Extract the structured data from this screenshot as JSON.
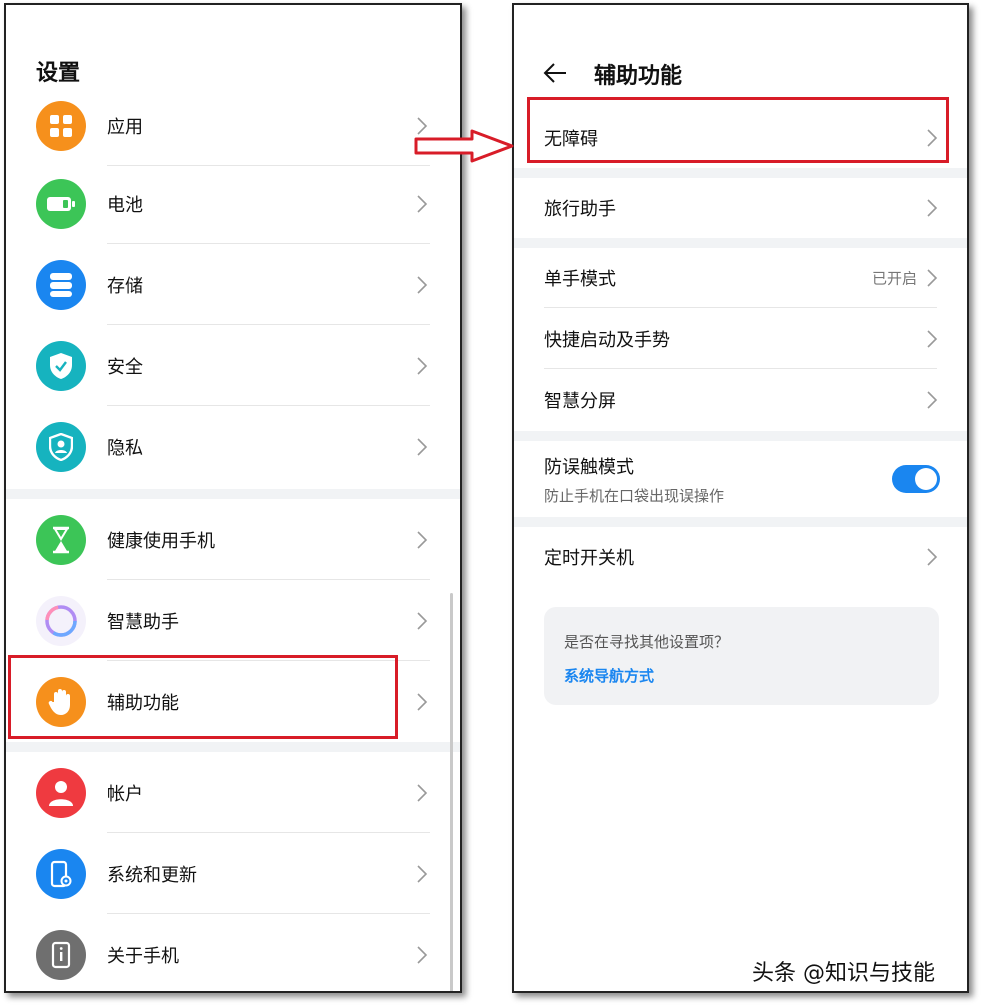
{
  "left": {
    "title": "设置",
    "items": [
      {
        "label": "应用",
        "icon": "apps-grid-icon",
        "color": "#f6901c"
      },
      {
        "label": "电池",
        "icon": "battery-icon",
        "color": "#3cc557"
      },
      {
        "label": "存储",
        "icon": "storage-icon",
        "color": "#1a86f0"
      },
      {
        "label": "安全",
        "icon": "shield-check-icon",
        "color": "#16b3bf"
      },
      {
        "label": "隐私",
        "icon": "privacy-icon",
        "color": "#16b3bf"
      },
      {
        "label": "健康使用手机",
        "icon": "hourglass-icon",
        "color": "#3cc557"
      },
      {
        "label": "智慧助手",
        "icon": "assistant-ring-icon",
        "color": "#8a6cf0"
      },
      {
        "label": "辅助功能",
        "icon": "hand-icon",
        "color": "#f6901c"
      },
      {
        "label": "帐户",
        "icon": "account-icon",
        "color": "#ef3a40"
      },
      {
        "label": "系统和更新",
        "icon": "system-update-icon",
        "color": "#1a86f0"
      },
      {
        "label": "关于手机",
        "icon": "phone-info-icon",
        "color": "#6f6f6f"
      }
    ]
  },
  "right": {
    "title": "辅助功能",
    "items": [
      {
        "label": "无障碍"
      },
      {
        "label": "旅行助手"
      },
      {
        "label": "单手模式",
        "status": "已开启"
      },
      {
        "label": "快捷启动及手势"
      },
      {
        "label": "智慧分屏"
      },
      {
        "label": "防误触模式",
        "sub": "防止手机在口袋出现误操作",
        "toggle": true
      },
      {
        "label": "定时开关机"
      }
    ],
    "suggest": {
      "question": "是否在寻找其他设置项？",
      "link": "系统导航方式"
    }
  },
  "accent_color": "#1a86f0",
  "highlight_color": "#d81c28",
  "watermark": "头条 @知识与技能"
}
